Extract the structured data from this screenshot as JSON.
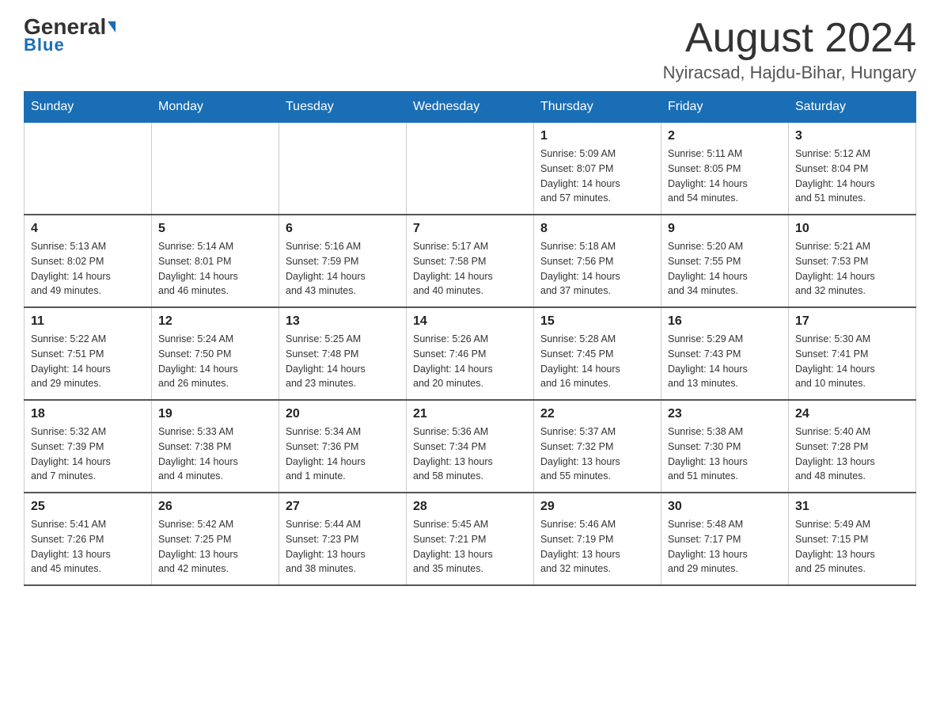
{
  "logo": {
    "general": "General",
    "blue": "Blue",
    "arrow": "▶"
  },
  "header": {
    "month_title": "August 2024",
    "location": "Nyiracsad, Hajdu-Bihar, Hungary"
  },
  "days_of_week": [
    "Sunday",
    "Monday",
    "Tuesday",
    "Wednesday",
    "Thursday",
    "Friday",
    "Saturday"
  ],
  "weeks": [
    [
      {
        "day": "",
        "info": ""
      },
      {
        "day": "",
        "info": ""
      },
      {
        "day": "",
        "info": ""
      },
      {
        "day": "",
        "info": ""
      },
      {
        "day": "1",
        "info": "Sunrise: 5:09 AM\nSunset: 8:07 PM\nDaylight: 14 hours\nand 57 minutes."
      },
      {
        "day": "2",
        "info": "Sunrise: 5:11 AM\nSunset: 8:05 PM\nDaylight: 14 hours\nand 54 minutes."
      },
      {
        "day": "3",
        "info": "Sunrise: 5:12 AM\nSunset: 8:04 PM\nDaylight: 14 hours\nand 51 minutes."
      }
    ],
    [
      {
        "day": "4",
        "info": "Sunrise: 5:13 AM\nSunset: 8:02 PM\nDaylight: 14 hours\nand 49 minutes."
      },
      {
        "day": "5",
        "info": "Sunrise: 5:14 AM\nSunset: 8:01 PM\nDaylight: 14 hours\nand 46 minutes."
      },
      {
        "day": "6",
        "info": "Sunrise: 5:16 AM\nSunset: 7:59 PM\nDaylight: 14 hours\nand 43 minutes."
      },
      {
        "day": "7",
        "info": "Sunrise: 5:17 AM\nSunset: 7:58 PM\nDaylight: 14 hours\nand 40 minutes."
      },
      {
        "day": "8",
        "info": "Sunrise: 5:18 AM\nSunset: 7:56 PM\nDaylight: 14 hours\nand 37 minutes."
      },
      {
        "day": "9",
        "info": "Sunrise: 5:20 AM\nSunset: 7:55 PM\nDaylight: 14 hours\nand 34 minutes."
      },
      {
        "day": "10",
        "info": "Sunrise: 5:21 AM\nSunset: 7:53 PM\nDaylight: 14 hours\nand 32 minutes."
      }
    ],
    [
      {
        "day": "11",
        "info": "Sunrise: 5:22 AM\nSunset: 7:51 PM\nDaylight: 14 hours\nand 29 minutes."
      },
      {
        "day": "12",
        "info": "Sunrise: 5:24 AM\nSunset: 7:50 PM\nDaylight: 14 hours\nand 26 minutes."
      },
      {
        "day": "13",
        "info": "Sunrise: 5:25 AM\nSunset: 7:48 PM\nDaylight: 14 hours\nand 23 minutes."
      },
      {
        "day": "14",
        "info": "Sunrise: 5:26 AM\nSunset: 7:46 PM\nDaylight: 14 hours\nand 20 minutes."
      },
      {
        "day": "15",
        "info": "Sunrise: 5:28 AM\nSunset: 7:45 PM\nDaylight: 14 hours\nand 16 minutes."
      },
      {
        "day": "16",
        "info": "Sunrise: 5:29 AM\nSunset: 7:43 PM\nDaylight: 14 hours\nand 13 minutes."
      },
      {
        "day": "17",
        "info": "Sunrise: 5:30 AM\nSunset: 7:41 PM\nDaylight: 14 hours\nand 10 minutes."
      }
    ],
    [
      {
        "day": "18",
        "info": "Sunrise: 5:32 AM\nSunset: 7:39 PM\nDaylight: 14 hours\nand 7 minutes."
      },
      {
        "day": "19",
        "info": "Sunrise: 5:33 AM\nSunset: 7:38 PM\nDaylight: 14 hours\nand 4 minutes."
      },
      {
        "day": "20",
        "info": "Sunrise: 5:34 AM\nSunset: 7:36 PM\nDaylight: 14 hours\nand 1 minute."
      },
      {
        "day": "21",
        "info": "Sunrise: 5:36 AM\nSunset: 7:34 PM\nDaylight: 13 hours\nand 58 minutes."
      },
      {
        "day": "22",
        "info": "Sunrise: 5:37 AM\nSunset: 7:32 PM\nDaylight: 13 hours\nand 55 minutes."
      },
      {
        "day": "23",
        "info": "Sunrise: 5:38 AM\nSunset: 7:30 PM\nDaylight: 13 hours\nand 51 minutes."
      },
      {
        "day": "24",
        "info": "Sunrise: 5:40 AM\nSunset: 7:28 PM\nDaylight: 13 hours\nand 48 minutes."
      }
    ],
    [
      {
        "day": "25",
        "info": "Sunrise: 5:41 AM\nSunset: 7:26 PM\nDaylight: 13 hours\nand 45 minutes."
      },
      {
        "day": "26",
        "info": "Sunrise: 5:42 AM\nSunset: 7:25 PM\nDaylight: 13 hours\nand 42 minutes."
      },
      {
        "day": "27",
        "info": "Sunrise: 5:44 AM\nSunset: 7:23 PM\nDaylight: 13 hours\nand 38 minutes."
      },
      {
        "day": "28",
        "info": "Sunrise: 5:45 AM\nSunset: 7:21 PM\nDaylight: 13 hours\nand 35 minutes."
      },
      {
        "day": "29",
        "info": "Sunrise: 5:46 AM\nSunset: 7:19 PM\nDaylight: 13 hours\nand 32 minutes."
      },
      {
        "day": "30",
        "info": "Sunrise: 5:48 AM\nSunset: 7:17 PM\nDaylight: 13 hours\nand 29 minutes."
      },
      {
        "day": "31",
        "info": "Sunrise: 5:49 AM\nSunset: 7:15 PM\nDaylight: 13 hours\nand 25 minutes."
      }
    ]
  ]
}
